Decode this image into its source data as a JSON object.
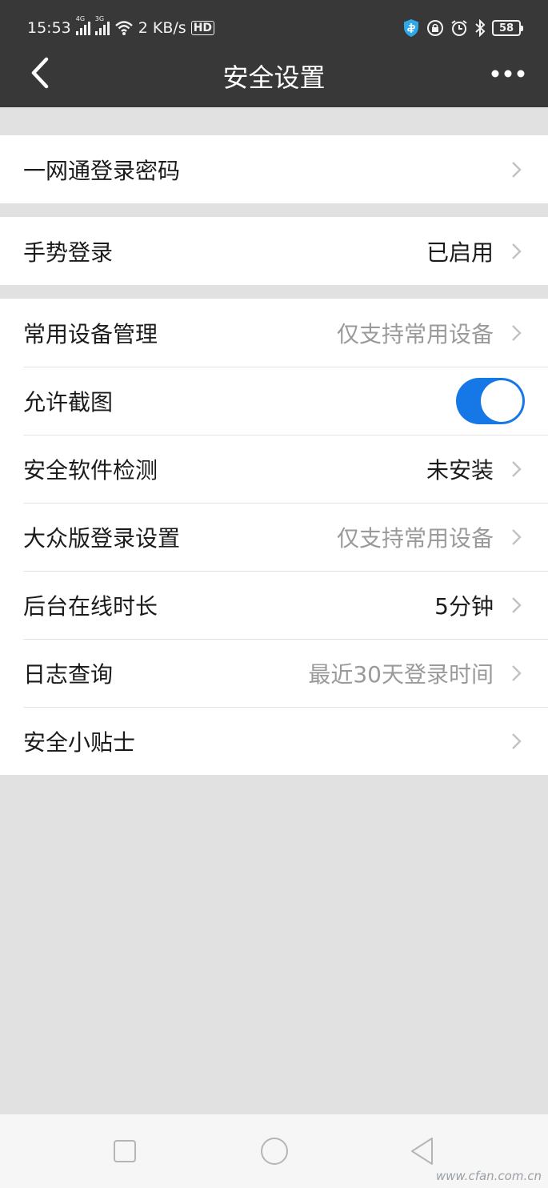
{
  "status_bar": {
    "time": "15:53",
    "signal_1_tag": "4G",
    "signal_2_tag": "3G",
    "speed": "2 KB/s",
    "hd_badge": "HD",
    "battery": "58",
    "icons": [
      "signal-4g-icon",
      "signal-3g-icon",
      "wifi-icon",
      "hd-call-icon",
      "shield-icon",
      "lock-rotation-icon",
      "alarm-icon",
      "bluetooth-icon",
      "battery-icon"
    ]
  },
  "header": {
    "title": "安全设置",
    "back_icon": "back-arrow-icon",
    "more_icon": "more-dots-icon"
  },
  "groups": [
    {
      "rows": [
        {
          "label": "一网通登录密码",
          "value": ""
        }
      ]
    },
    {
      "rows": [
        {
          "label": "手势登录",
          "value": "已启用"
        }
      ]
    },
    {
      "rows": [
        {
          "label": "常用设备管理",
          "value": "仅支持常用设备",
          "muted": true
        },
        {
          "label": "允许截图",
          "toggle": true
        },
        {
          "label": "安全软件检测",
          "value": "未安装"
        },
        {
          "label": "大众版登录设置",
          "value": "仅支持常用设备",
          "muted": true
        },
        {
          "label": "后台在线时长",
          "value": "5分钟"
        },
        {
          "label": "日志查询",
          "value": "最近30天登录时间",
          "muted": true
        },
        {
          "label": "安全小贴士",
          "value": ""
        }
      ]
    }
  ],
  "colors": {
    "header_bg": "#383838",
    "page_bg": "#e1e1e1",
    "toggle_on": "#1677e6",
    "muted_text": "#9a9a9a"
  },
  "system_nav": {
    "icons": [
      "recent-apps-square-icon",
      "home-circle-icon",
      "back-triangle-icon"
    ]
  },
  "watermark": "www.cfan.com.cn"
}
